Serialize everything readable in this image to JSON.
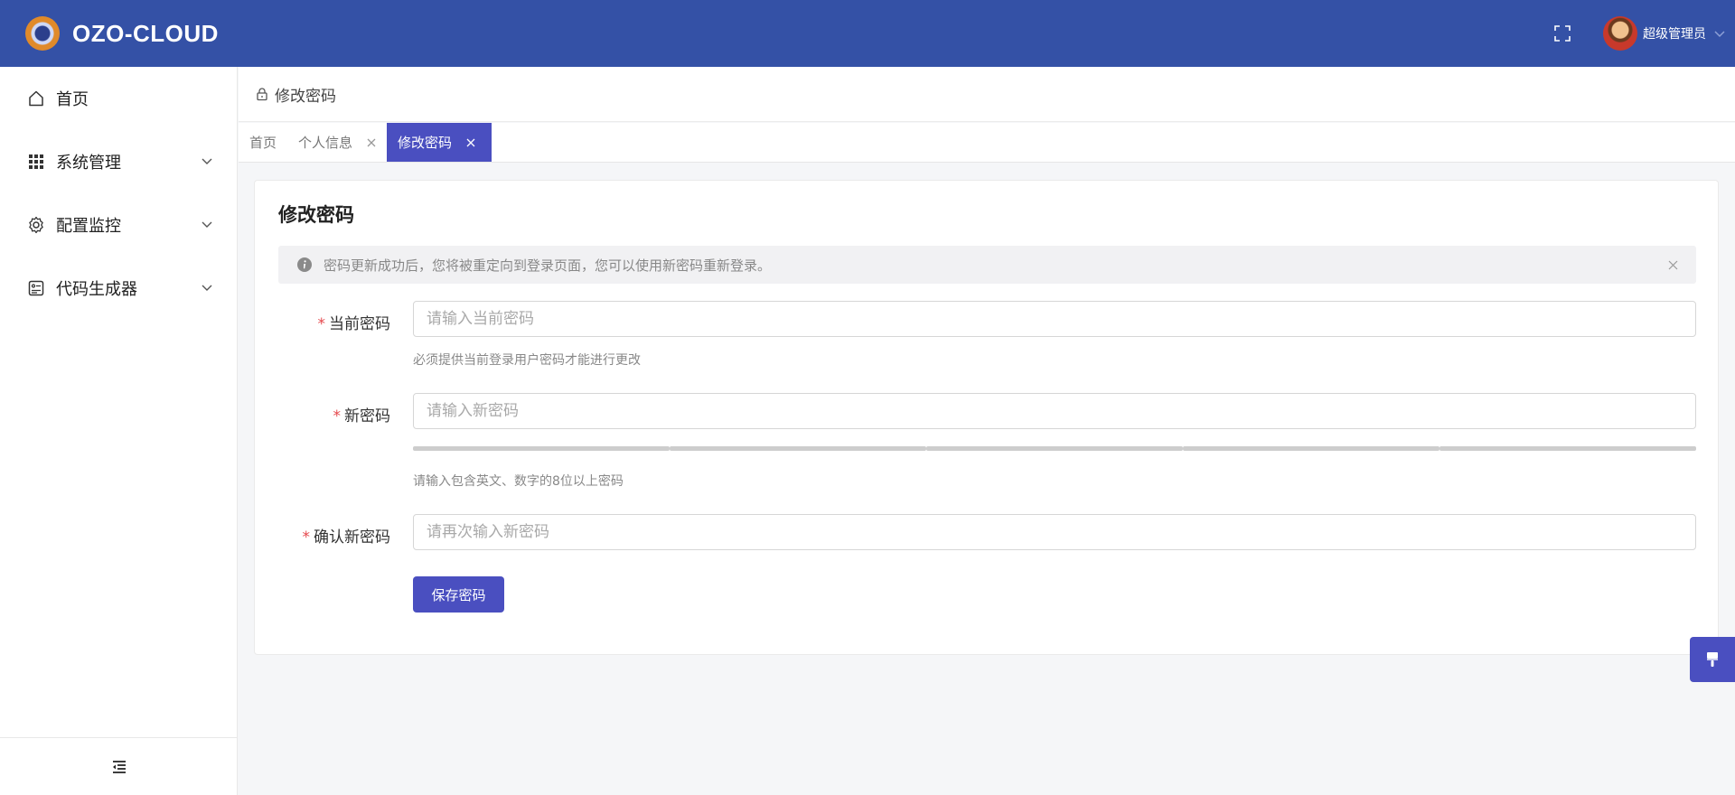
{
  "header": {
    "brand": "OZO-CLOUD",
    "user_name": "超级管理员",
    "icons": [
      "fullscreen-icon",
      "avatar",
      "chevron-down-icon"
    ]
  },
  "sidebar": {
    "items": [
      {
        "label": "首页",
        "icon": "home-icon"
      },
      {
        "label": "系统管理",
        "icon": "grid-icon",
        "expandable": true
      },
      {
        "label": "配置监控",
        "icon": "gear-icon",
        "expandable": true
      },
      {
        "label": "代码生成器",
        "icon": "code-generator-icon",
        "expandable": true
      }
    ],
    "footer_icon": "collapse-menu-icon"
  },
  "breadcrumb": {
    "text": "修改密码",
    "icon": "lock-icon"
  },
  "tabs": [
    {
      "label": "首页",
      "closable": false,
      "active": false
    },
    {
      "label": "个人信息",
      "closable": true,
      "active": false
    },
    {
      "label": "修改密码",
      "closable": true,
      "active": true
    }
  ],
  "form": {
    "title": "修改密码",
    "alert": "密码更新成功后，您将被重定向到登录页面，您可以使用新密码重新登录。",
    "fields": {
      "current": {
        "required_mark": "*",
        "label": "当前密码",
        "placeholder": "请输入当前密码",
        "help": "必须提供当前登录用户密码才能进行更改"
      },
      "new": {
        "required_mark": "*",
        "label": "新密码",
        "placeholder": "请输入新密码",
        "help": "请输入包含英文、数字的8位以上密码",
        "strength_segments": 5,
        "strength_level": 0
      },
      "confirm": {
        "required_mark": "*",
        "label": "确认新密码",
        "placeholder": "请再次输入新密码"
      }
    },
    "save_label": "保存密码"
  },
  "colors": {
    "header_bg": "#3451a6",
    "primary": "#4a4fc0",
    "required": "#e5484d"
  }
}
